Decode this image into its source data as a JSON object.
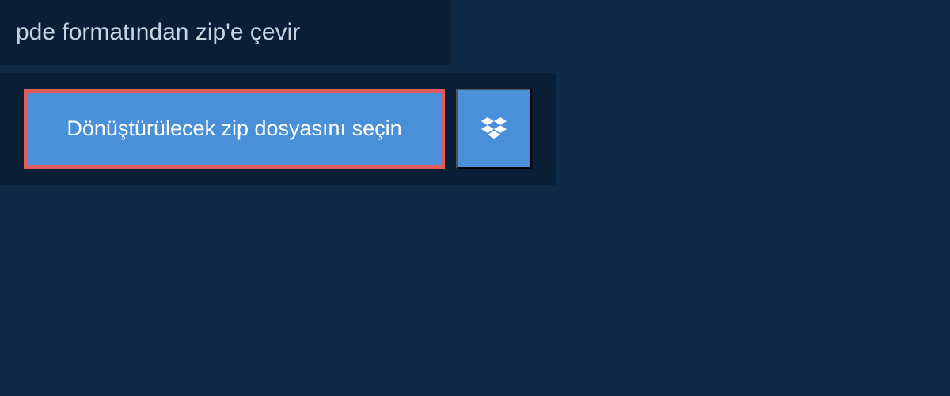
{
  "header": {
    "title": "pde formatından zip'e çevir"
  },
  "actions": {
    "select_file_label": "Dönüştürülecek zip dosyasını seçin",
    "dropbox_icon": "dropbox"
  },
  "colors": {
    "background": "#0e2a47",
    "panel": "#0a1f36",
    "button": "#4a90d9",
    "highlight_border": "#e05b5b",
    "text_light": "#c8d4e0",
    "text_white": "#ffffff"
  }
}
